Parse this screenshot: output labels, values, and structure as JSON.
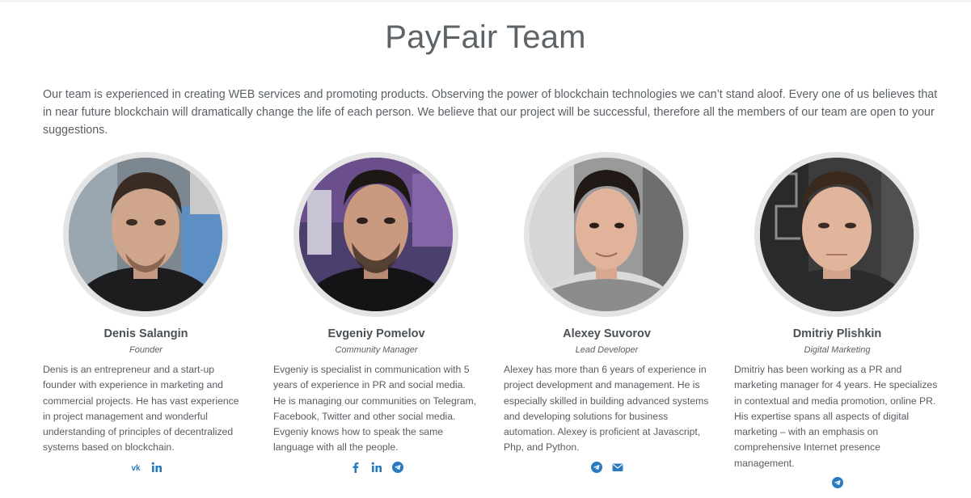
{
  "section": {
    "title": "PayFair Team",
    "intro": "Our team is experienced in creating WEB services and promoting products. Observing the power of blockchain technologies we can’t stand aloof. Every one of us believes that in near future blockchain will dramatically change the life of each person. We believe that our project will be successful, therefore all the members of our team are open to your suggestions."
  },
  "colors": {
    "accent": "#2a7ac0",
    "text": "#555b61",
    "photo_ring": "#e4e4e4"
  },
  "members": [
    {
      "name": "Denis Salangin",
      "role": "Founder",
      "bio": "Denis is an entrepreneur and a start-up founder with experience in marketing and commercial projects. He has vast experience in project management and wonderful understanding of principles of decentralized systems based on blockchain.",
      "socials": [
        "vk-icon",
        "linkedin-icon"
      ]
    },
    {
      "name": "Evgeniy Pomelov",
      "role": "Community Manager",
      "bio": "Evgeniy is specialist in communication with 5 years of experience in PR and social media. He is managing our communities on Telegram, Facebook, Twitter and other social media. Evgeniy knows how to speak the same language with all the people.",
      "socials": [
        "facebook-icon",
        "linkedin-icon",
        "telegram-icon"
      ]
    },
    {
      "name": "Alexey Suvorov",
      "role": "Lead Developer",
      "bio": "Alexey has more than 6 years of experience in project development and management. He is especially skilled in building advanced systems and developing solutions for business automation. Alexey is proficient at Javascript, Php, and Python.",
      "socials": [
        "telegram-icon",
        "email-icon"
      ]
    },
    {
      "name": "Dmitriy Plishkin",
      "role": "Digital Marketing",
      "bio": "Dmitriy has been working as a PR and marketing manager for 4 years. He specializes in contextual and media promotion, online PR. His expertise spans all aspects of digital marketing – with an emphasis on comprehensive Internet presence management.",
      "socials": [
        "telegram-icon"
      ]
    }
  ]
}
